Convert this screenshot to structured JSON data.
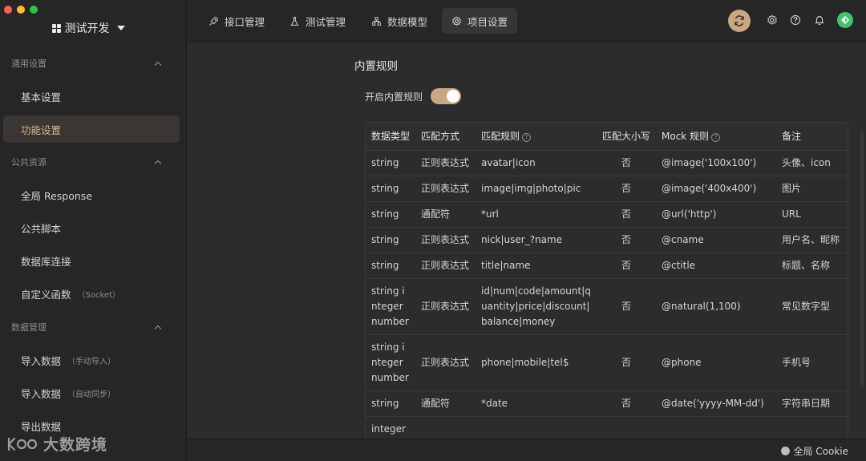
{
  "sidebar": {
    "workspace": "测试开发",
    "groups": [
      {
        "title": "通用设置",
        "items": [
          {
            "label": "基本设置",
            "sub": ""
          },
          {
            "label": "功能设置",
            "sub": ""
          }
        ]
      },
      {
        "title": "公共资源",
        "items": [
          {
            "label": "全局 Response",
            "sub": ""
          },
          {
            "label": "公共脚本",
            "sub": ""
          },
          {
            "label": "数据库连接",
            "sub": ""
          },
          {
            "label": "自定义函数",
            "sub": "（Socket）"
          }
        ]
      },
      {
        "title": "数据管理",
        "items": [
          {
            "label": "导入数据",
            "sub": "（手动导入）"
          },
          {
            "label": "导入数据",
            "sub": "（自动同步）"
          },
          {
            "label": "导出数据",
            "sub": ""
          }
        ]
      }
    ],
    "active_item": "功能设置",
    "brand": "大数跨境"
  },
  "topbar": {
    "tabs": [
      {
        "label": "接口管理",
        "icon": "rocket-icon"
      },
      {
        "label": "测试管理",
        "icon": "flask-icon"
      },
      {
        "label": "数据模型",
        "icon": "hierarchy-icon"
      },
      {
        "label": "项目设置",
        "icon": "gear-icon"
      }
    ],
    "active_tab": "项目设置",
    "icons": [
      "sync-icon",
      "settings-icon",
      "help-icon",
      "bell-icon",
      "avatar"
    ]
  },
  "main": {
    "section_title": "内置规则",
    "toggle_label": "开启内置规则",
    "toggle_on": true,
    "table": {
      "headers": [
        "数据类型",
        "匹配方式",
        "匹配规则",
        "匹配大小写",
        "Mock 规则",
        "备注"
      ],
      "rows": [
        {
          "type": "string",
          "method": "正则表达式",
          "rule": "avatar|icon",
          "case": "否",
          "mock": "@image('100x100')",
          "note": "头像、icon"
        },
        {
          "type": "string",
          "method": "正则表达式",
          "rule": "image|img|photo|pic",
          "case": "否",
          "mock": "@image('400x400')",
          "note": "图片"
        },
        {
          "type": "string",
          "method": "通配符",
          "rule": "*url",
          "case": "否",
          "mock": "@url('http')",
          "note": "URL"
        },
        {
          "type": "string",
          "method": "正则表达式",
          "rule": "nick|user_?name",
          "case": "否",
          "mock": "@cname",
          "note": "用户名、昵称"
        },
        {
          "type": "string",
          "method": "正则表达式",
          "rule": "title|name",
          "case": "否",
          "mock": "@ctitle",
          "note": "标题、名称"
        },
        {
          "type": "string integer number",
          "method": "正则表达式",
          "rule": "id|num|code|amount|quantity|price|discount|balance|money",
          "case": "否",
          "mock": "@natural(1,100)",
          "note": "常见数字型"
        },
        {
          "type": "string integer number",
          "method": "正则表达式",
          "rule": "phone|mobile|tel$",
          "case": "否",
          "mock": "@phone",
          "note": "手机号"
        },
        {
          "type": "string",
          "method": "通配符",
          "rule": "*date",
          "case": "否",
          "mock": "@date('yyyy-MM-dd')",
          "note": "字符串日期"
        },
        {
          "type": "integer",
          "method": "",
          "rule": "",
          "case": "",
          "mock": "",
          "note": ""
        }
      ]
    }
  },
  "footer": {
    "cookie_label": "全局 Cookie"
  },
  "colors": {
    "accent": "#c9a881",
    "active_text": "#d8b68c",
    "bg": "#2b2b2b"
  }
}
